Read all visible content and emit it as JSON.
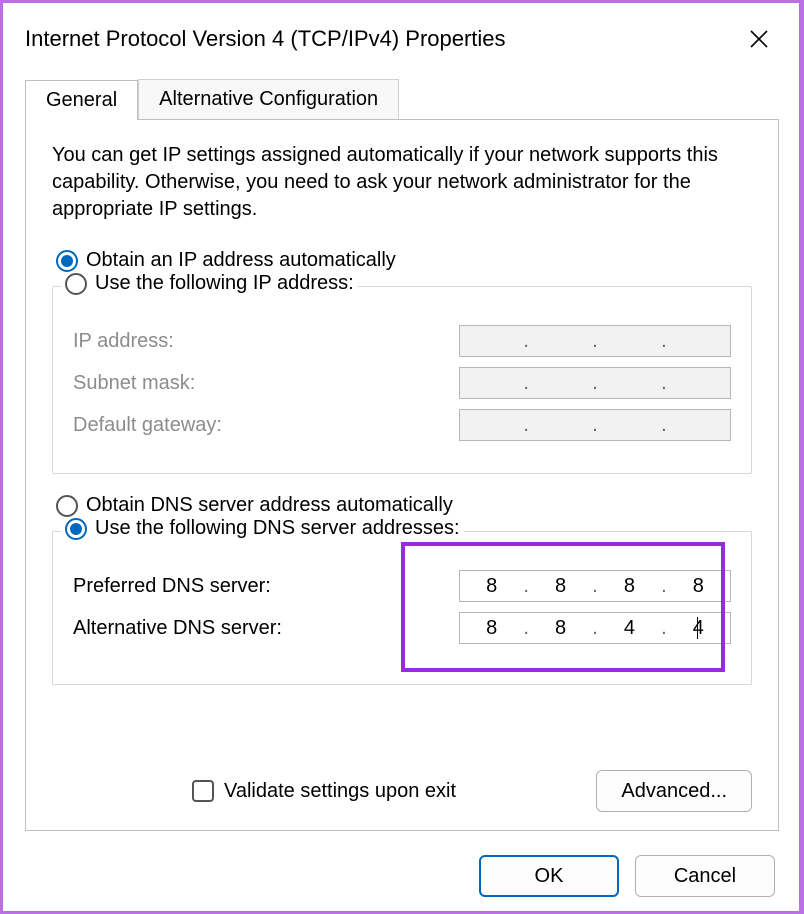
{
  "titlebar": {
    "title": "Internet Protocol Version 4 (TCP/IPv4) Properties"
  },
  "tabs": {
    "general": "General",
    "alternative": "Alternative Configuration"
  },
  "description": "You can get IP settings assigned automatically if your network supports this capability. Otherwise, you need to ask your network administrator for the appropriate IP settings.",
  "ip_section": {
    "obtain_auto_label": "Obtain an IP address automatically",
    "use_following_label": "Use the following IP address:",
    "ip_address_label": "IP address:",
    "subnet_label": "Subnet mask:",
    "gateway_label": "Default gateway:"
  },
  "dns_section": {
    "obtain_auto_label": "Obtain DNS server address automatically",
    "use_following_label": "Use the following DNS server addresses:",
    "preferred_label": "Preferred DNS server:",
    "alternative_label": "Alternative DNS server:",
    "preferred_value": {
      "o1": "8",
      "o2": "8",
      "o3": "8",
      "o4": "8"
    },
    "alternative_value": {
      "o1": "8",
      "o2": "8",
      "o3": "4",
      "o4": "4"
    }
  },
  "validate_label": "Validate settings upon exit",
  "buttons": {
    "advanced": "Advanced...",
    "ok": "OK",
    "cancel": "Cancel"
  }
}
